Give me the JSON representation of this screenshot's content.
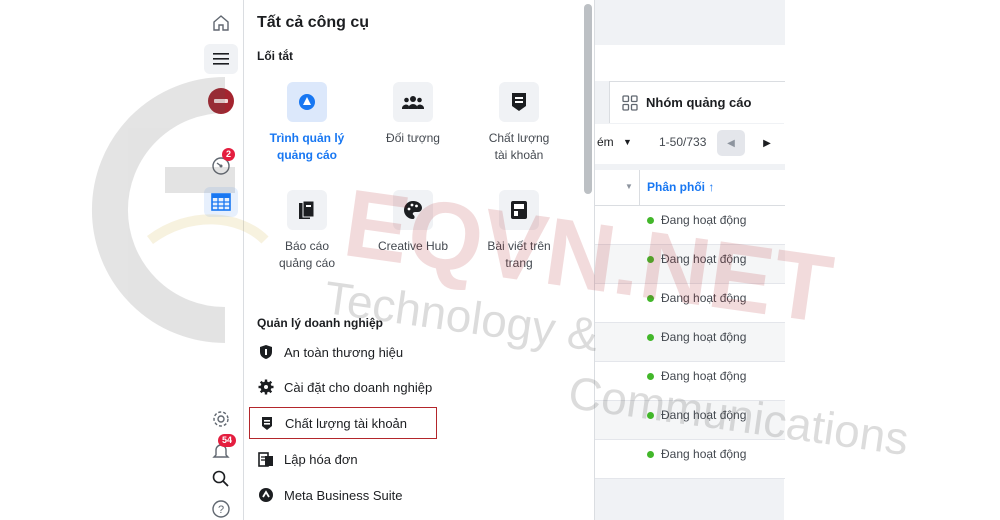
{
  "rail": {
    "notification_badge": "2",
    "alerts_badge": "54"
  },
  "panel": {
    "title": "Tất cả công cụ",
    "shortcuts_label": "Lối tắt",
    "shortcuts": [
      {
        "line1": "Trình quản lý",
        "line2": "quảng cáo",
        "icon": "ads-manager-icon"
      },
      {
        "line1": "Đối tượng",
        "line2": "",
        "icon": "audience-icon"
      },
      {
        "line1": "Chất lượng",
        "line2": "tài khoản",
        "icon": "account-quality-icon"
      },
      {
        "line1": "Báo cáo",
        "line2": "quảng cáo",
        "icon": "ads-reporting-icon"
      },
      {
        "line1": "Creative Hub",
        "line2": "",
        "icon": "creative-hub-icon"
      },
      {
        "line1": "Bài viết trên",
        "line2": "trang",
        "icon": "page-posts-icon"
      }
    ],
    "business_label": "Quản lý doanh nghiệp",
    "business_items": [
      {
        "label": "An toàn thương hiệu",
        "icon": "shield-icon"
      },
      {
        "label": "Cài đặt cho doanh nghiệp",
        "icon": "gear-icon"
      },
      {
        "label": "Chất lượng tài khoản",
        "icon": "account-quality-icon"
      },
      {
        "label": "Lập hóa đơn",
        "icon": "billing-icon"
      },
      {
        "label": "Meta Business Suite",
        "icon": "business-suite-icon"
      }
    ]
  },
  "background": {
    "tab_label": "Nhóm quảng cáo",
    "view_label": "ém",
    "pagination": "1-50/733",
    "column_header": "Phân phối ↑",
    "rows": [
      "Đang hoạt động",
      "Đang hoạt động",
      "Đang hoạt động",
      "Đang hoạt động",
      "Đang hoạt động",
      "Đang hoạt động",
      "Đang hoạt động"
    ]
  },
  "watermark": {
    "brand": "EQVN.NET",
    "line1": "Technology &",
    "line2": "Communications"
  },
  "colors": {
    "accent": "#1877f2",
    "highlight_border": "#b3262b",
    "status_green": "#42b72a",
    "badge_red": "#e41e3f"
  }
}
